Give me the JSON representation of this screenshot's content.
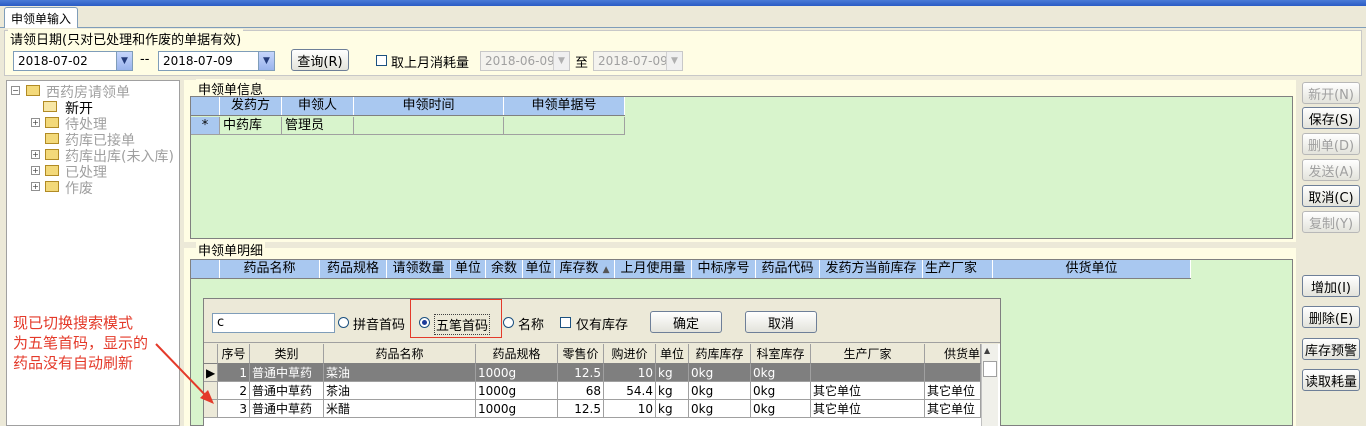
{
  "tab": {
    "label": "申领单输入"
  },
  "filter": {
    "legend": "请领日期(只对已处理和作废的单据有效)",
    "date_from": "2018-07-02",
    "date_sep": "--",
    "date_to": "2018-07-09",
    "query_label": "查询(R)",
    "last_month_label": "取上月消耗量",
    "last_from": "2018-06-09",
    "to_label": "至",
    "last_to": "2018-07-09"
  },
  "tree": {
    "root": "西药房请领单",
    "items": [
      "新开",
      "待处理",
      "药库已接单",
      "药库出库(未入库)",
      "已处理",
      "作废"
    ]
  },
  "info": {
    "legend": "申领单信息",
    "columns": [
      "发药方",
      "申领人",
      "申领时间",
      "申领单据号"
    ],
    "row_marker": "*",
    "row": [
      "中药库",
      "管理员",
      "",
      ""
    ]
  },
  "detail": {
    "legend": "申领单明细",
    "columns": [
      "药品名称",
      "药品规格",
      "请领数量",
      "单位",
      "余数",
      "单位",
      "库存数",
      "上月使用量",
      "中标序号",
      "药品代码",
      "发药方当前库存",
      "生产厂家",
      "供货单位"
    ]
  },
  "right_buttons": [
    "新开(N)",
    "保存(S)",
    "删单(D)",
    "发送(A)",
    "取消(C)",
    "复制(Y)",
    "增加(I)",
    "删除(E)",
    "库存预警",
    "读取耗量"
  ],
  "popup": {
    "search_value": "c",
    "opt_pinyin": "拼音首码",
    "opt_wubi": "五笔首码",
    "opt_name": "名称",
    "opt_stock": "仅有库存",
    "ok_label": "确定",
    "cancel_label": "取消",
    "columns": [
      "序号",
      "类别",
      "药品名称",
      "药品规格",
      "零售价",
      "购进价",
      "单位",
      "药库库存",
      "科室库存",
      "生产厂家",
      "供货单"
    ],
    "rows": [
      [
        "1",
        "普通中草药",
        "菜油",
        "1000g",
        "12.5",
        "10",
        "kg",
        "0kg",
        "0kg",
        "",
        ""
      ],
      [
        "2",
        "普通中草药",
        "茶油",
        "1000g",
        "68",
        "54.4",
        "kg",
        "0kg",
        "0kg",
        "其它单位",
        "其它单位"
      ],
      [
        "3",
        "普通中草药",
        "米醋",
        "1000g",
        "12.5",
        "10",
        "kg",
        "0kg",
        "0kg",
        "其它单位",
        "其它单位"
      ]
    ]
  },
  "annotation": {
    "line1": "现已切换搜索模式",
    "line2": "为五笔首码，显示的",
    "line3": "药品没有自动刷新"
  },
  "colors": {
    "accent": "#a9c8f0",
    "grid_bg": "#d8f4cc",
    "annotation": "#e43a2a"
  }
}
